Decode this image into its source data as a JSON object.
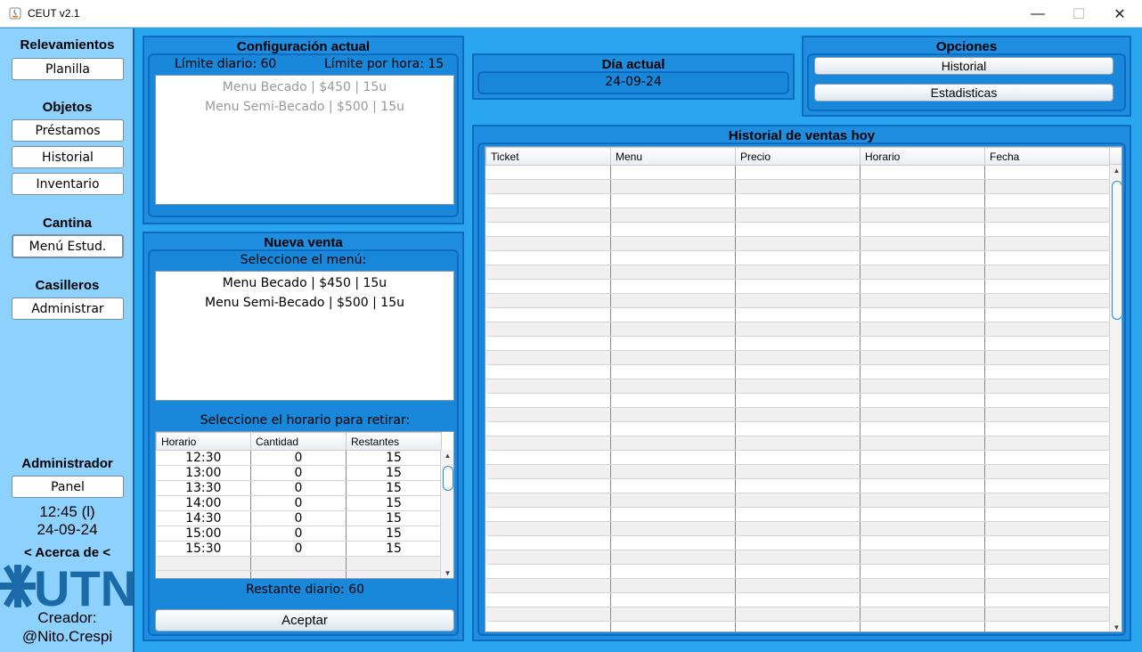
{
  "window": {
    "title": "CEUT v2.1",
    "min": "—",
    "max": "☐",
    "close": "✕"
  },
  "sidebar": {
    "relevamientos": {
      "title": "Relevamientos",
      "planilla": "Planilla"
    },
    "objetos": {
      "title": "Objetos",
      "prestamos": "Préstamos",
      "historial": "Historial",
      "inventario": "Inventario"
    },
    "cantina": {
      "title": "Cantina",
      "menu": "Menú Estud."
    },
    "casilleros": {
      "title": "Casilleros",
      "administrar": "Administrar"
    },
    "administrador": {
      "title": "Administrador",
      "panel": "Panel"
    },
    "time": "12:45 (l)",
    "date": "24-09-24",
    "acerca": "< Acerca de <",
    "logo_text": "UTN",
    "creador_label": "Creador:",
    "creador_name": "@Nito.Crespi"
  },
  "config": {
    "title": "Configuración actual",
    "limite_diario": "Límite diario: 60",
    "limite_hora": "Límite por hora: 15",
    "items": [
      "Menu Becado | $450 | 15u",
      "Menu Semi-Becado | $500 | 15u"
    ]
  },
  "nueva_venta": {
    "title": "Nueva venta",
    "seleccione_menu": "Seleccione el menú:",
    "menus": [
      "Menu Becado | $450 | 15u",
      "Menu Semi-Becado | $500 | 15u"
    ],
    "seleccione_horario": "Seleccione el horario para retirar:",
    "horario_cols": [
      "Horario",
      "Cantidad",
      "Restantes"
    ],
    "horarios": [
      [
        "12:30",
        "0",
        "15"
      ],
      [
        "13:00",
        "0",
        "15"
      ],
      [
        "13:30",
        "0",
        "15"
      ],
      [
        "14:00",
        "0",
        "15"
      ],
      [
        "14:30",
        "0",
        "15"
      ],
      [
        "15:00",
        "0",
        "15"
      ],
      [
        "15:30",
        "0",
        "15"
      ],
      [
        "",
        "",
        ""
      ],
      [
        "",
        "",
        ""
      ]
    ],
    "restante": "Restante diario: 60",
    "aceptar": "Aceptar"
  },
  "dia_actual": {
    "title": "Día actual",
    "value": "24-09-24"
  },
  "opciones": {
    "title": "Opciones",
    "historial": "Historial",
    "estadisticas": "Estadisticas"
  },
  "historial_ventas": {
    "title": "Historial de ventas hoy",
    "cols": [
      "Ticket",
      "Menu",
      "Precio",
      "Horario",
      "Fecha"
    ]
  },
  "colors": {
    "background": "#2aa6f0",
    "sidebar": "#8dd1ff",
    "panel": "#1f8ee0",
    "panel_border": "#0b6dbf"
  }
}
